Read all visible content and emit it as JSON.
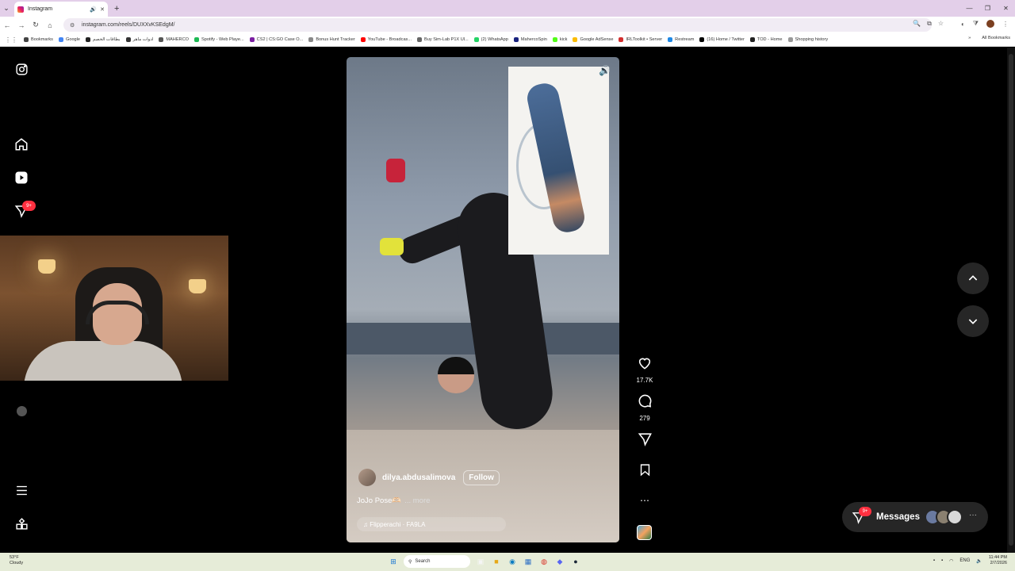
{
  "browser": {
    "tab_title": "Instagram",
    "url": "instagram.com/reels/DUXXvKSEdgM/",
    "bookmarks": [
      "Bookmarks",
      "Google",
      "بطاقات الخصم",
      "ادوات ماهر",
      "MAHERCO",
      "Spotify - Web Playe...",
      "CS2 | CS:GO Case O...",
      "Bonus Hunt Tracker",
      "YouTube - Broadcas...",
      "Buy Sim-Lab P1X Ul...",
      "(2) WhatsApp",
      "MahercoSpin",
      "kick",
      "Google AdSense",
      "IRLToolkit • Server",
      "Restream",
      "(16) Home / Twitter",
      "TOD - Home",
      "Shopping history"
    ],
    "all_bookmarks": "All Bookmarks",
    "colors": {
      "tabbar": "#e3cfe9",
      "page_bg": "#000000"
    }
  },
  "sidebar": {
    "icons": [
      "instagram-logo-icon",
      "home-icon",
      "reels-icon",
      "messages-icon",
      "profile-icon",
      "menu-icon",
      "more-apps-icon"
    ],
    "notification_badge": "9+"
  },
  "reel": {
    "username": "dilya.abdusalimova",
    "follow_label": "Follow",
    "caption": "JoJo Pose🫶🏻",
    "more_label": "... more",
    "audio": "♫ Flipperachi · FA9LA"
  },
  "actions": {
    "likes": "17.7K",
    "comments": "279"
  },
  "messages": {
    "badge": "9+",
    "label": "Messages"
  },
  "taskbar": {
    "weather_temp": "53°F",
    "weather_desc": "Cloudy",
    "search_placeholder": "Search",
    "language": "ENG",
    "time": "11:44 PM",
    "date": "2/7/2026"
  }
}
